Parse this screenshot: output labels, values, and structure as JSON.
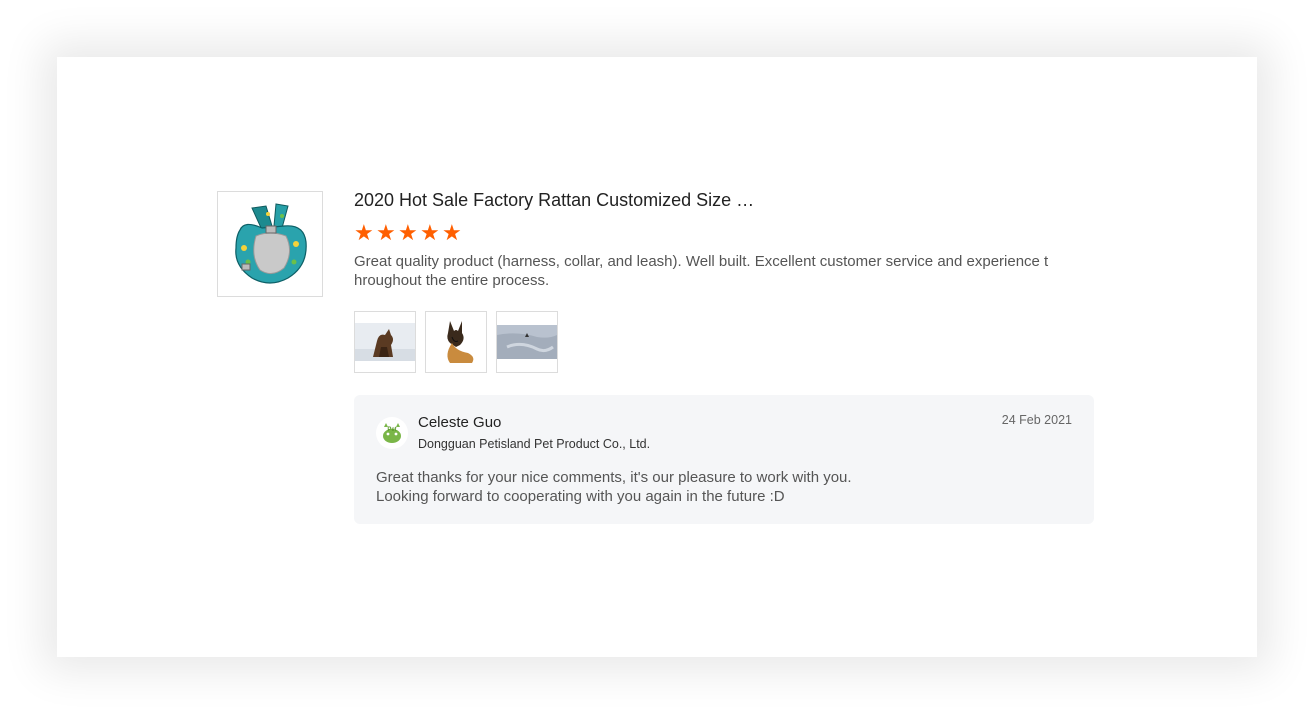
{
  "review": {
    "product_title": "2020 Hot Sale Factory Rattan Customized Size …",
    "rating": 5,
    "rating_max": 5,
    "text": "Great quality product (harness, collar, and leash). Well built. Excellent customer service and experience throughout the entire process.",
    "photos": [
      "dog-photo-1",
      "dog-photo-2",
      "dog-photo-3"
    ]
  },
  "reply": {
    "name": "Celeste Guo",
    "company": "Dongguan Petisland Pet Product Co., Ltd.",
    "date": "24 Feb 2021",
    "line1": "Great thanks for your nice comments, it's our pleasure to work with you.",
    "line2": "Looking forward to cooperating with you again in the future :D",
    "avatar_text": "Pet"
  },
  "colors": {
    "star": "#ff5f00",
    "reply_bg": "#f5f6f8",
    "logo_green": "#7ab648"
  },
  "icons": {
    "star": "star-icon"
  }
}
